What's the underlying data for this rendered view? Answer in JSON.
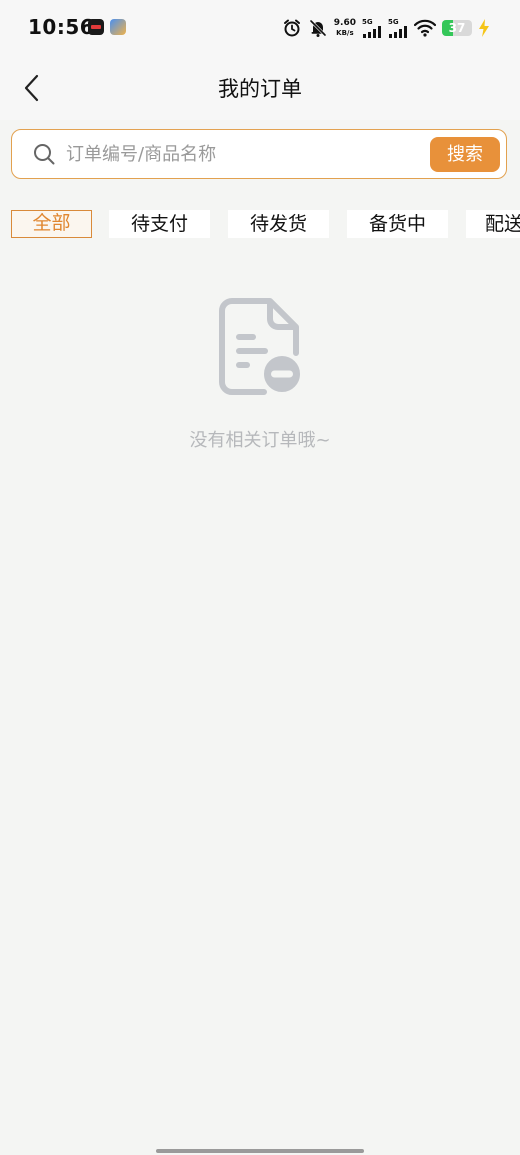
{
  "status_bar": {
    "time": "10:56",
    "net_speed_value": "9.60",
    "net_speed_unit": "KB/s",
    "sim1_label": "5G",
    "sim2_label": "5G",
    "battery_level": "37",
    "battery_percent": 37,
    "battery_color": "#34c759",
    "charging_color": "#f5c518"
  },
  "header": {
    "title": "我的订单",
    "back_icon": "chevron-left-icon"
  },
  "search": {
    "placeholder": "订单编号/商品名称",
    "button_label": "搜索",
    "accent_color": "#e8913a"
  },
  "tabs": [
    {
      "label": "全部",
      "active": true
    },
    {
      "label": "待支付",
      "active": false
    },
    {
      "label": "待发货",
      "active": false
    },
    {
      "label": "备货中",
      "active": false
    },
    {
      "label": "配送中",
      "active": false
    }
  ],
  "empty_state": {
    "icon": "empty-document-icon",
    "message": "没有相关订单哦~"
  }
}
